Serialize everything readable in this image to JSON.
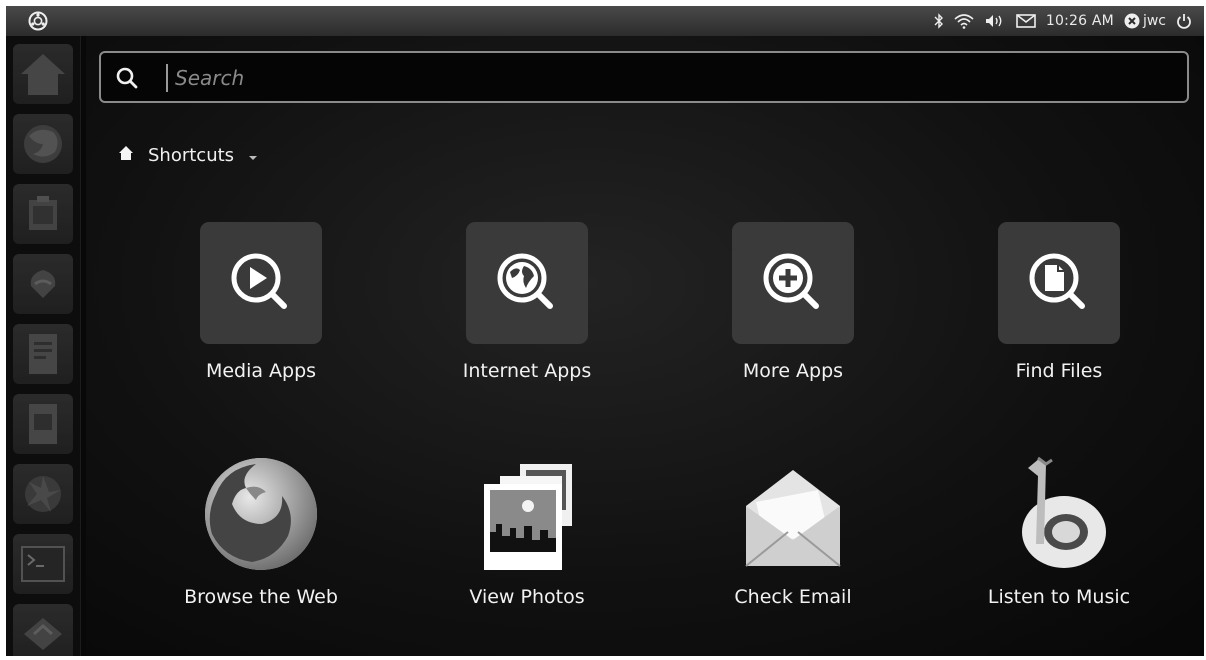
{
  "panel": {
    "clock": "10:26 AM",
    "user": "jwc",
    "icons": [
      "ubuntu-logo-icon",
      "bluetooth-icon",
      "wifi-icon",
      "volume-icon",
      "mail-icon",
      "user-icon",
      "power-icon"
    ]
  },
  "launcher": {
    "items": [
      "home-icon",
      "firefox-icon",
      "archive-icon",
      "inkscape-icon",
      "document-icon",
      "presentation-icon",
      "shutter-icon",
      "terminal-icon",
      "update-icon"
    ]
  },
  "search": {
    "placeholder": "Search"
  },
  "filter": {
    "label": "Shortcuts"
  },
  "shortcuts": [
    {
      "label": "Media Apps",
      "icon": "media-search-icon"
    },
    {
      "label": "Internet Apps",
      "icon": "globe-search-icon"
    },
    {
      "label": "More Apps",
      "icon": "plus-search-icon"
    },
    {
      "label": "Find Files",
      "icon": "file-search-icon"
    }
  ],
  "apps": [
    {
      "label": "Browse the Web",
      "icon": "firefox-icon"
    },
    {
      "label": "View Photos",
      "icon": "photos-icon"
    },
    {
      "label": "Check Email",
      "icon": "email-icon"
    },
    {
      "label": "Listen to Music",
      "icon": "banshee-icon"
    }
  ],
  "colors": {
    "panel": "#3a3a3a",
    "dash_bg": "#111111",
    "tile": "#3a3a3a",
    "text": "#f2f2f2"
  }
}
